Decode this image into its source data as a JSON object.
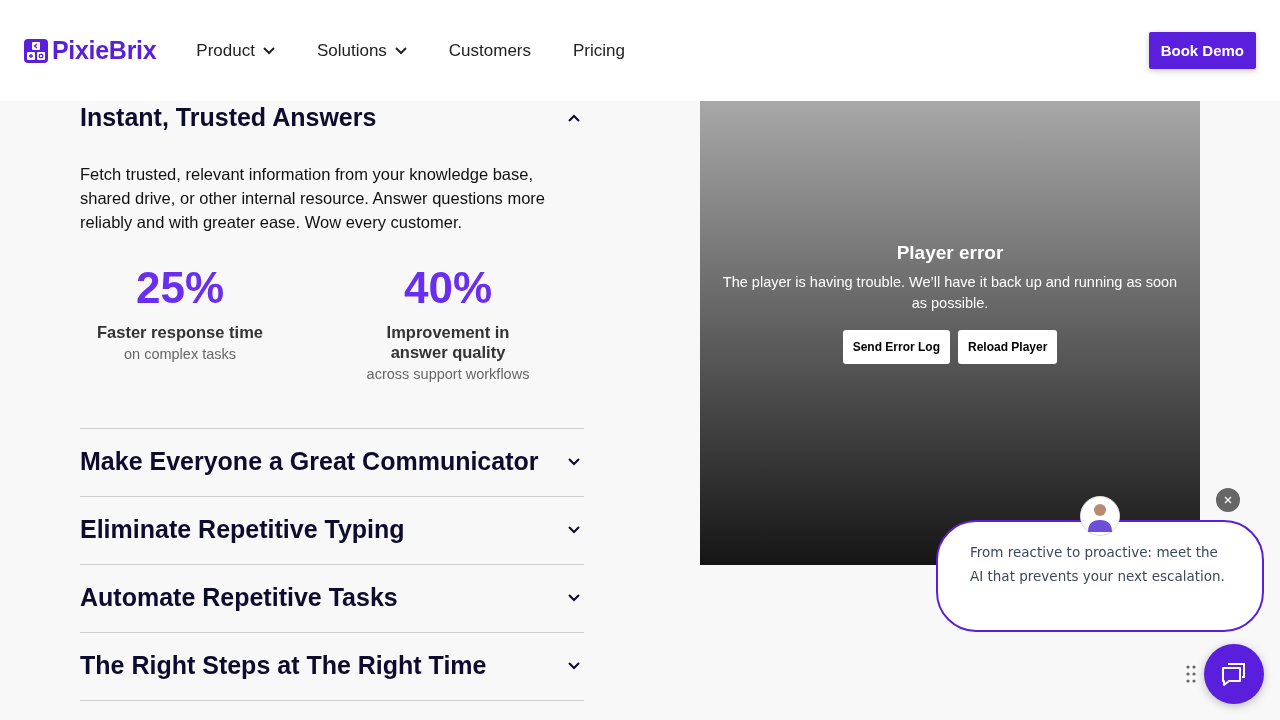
{
  "header": {
    "logo": "PixieBrix",
    "nav": [
      {
        "label": "Product",
        "dropdown": true
      },
      {
        "label": "Solutions",
        "dropdown": true
      },
      {
        "label": "Customers",
        "dropdown": false
      },
      {
        "label": "Pricing",
        "dropdown": false
      }
    ],
    "cta": "Book Demo"
  },
  "accordion": [
    {
      "title": "Instant, Trusted Answers",
      "expanded": true,
      "description": "Fetch trusted, relevant information from your knowledge base, shared drive, or other internal resource. Answer questions more reliably and with greater ease. Wow every customer.",
      "stats": [
        {
          "value": "25%",
          "label": "Faster response time",
          "note": "on complex tasks"
        },
        {
          "value": "40%",
          "label": "Improvement in answer quality",
          "note": "across support workflows"
        }
      ]
    },
    {
      "title": "Make Everyone a Great Communicator",
      "expanded": false
    },
    {
      "title": "Eliminate Repetitive Typing",
      "expanded": false
    },
    {
      "title": "Automate Repetitive Tasks",
      "expanded": false
    },
    {
      "title": "The Right Steps at The Right Time",
      "expanded": false
    }
  ],
  "player": {
    "title": "Player error",
    "message": "The player is having trouble. We’ll have it back up and running as soon as possible.",
    "buttons": [
      "Send Error Log",
      "Reload Player"
    ]
  },
  "chat": {
    "message": "From reactive to proactive: meet the AI that prevents your next escalation."
  }
}
